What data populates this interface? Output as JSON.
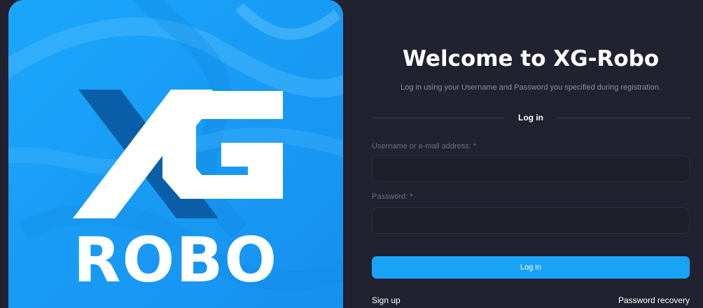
{
  "brand": {
    "logo_letters": "XG",
    "wordmark": "ROBO",
    "background_color": "#1a9df7"
  },
  "login": {
    "title": "Welcome to XG-Robo",
    "subtitle": "Log in using your Username and Password you specified during registration.",
    "section_title": "Log in",
    "username_label": "Username or e-mail address: *",
    "username_value": "",
    "password_label": "Password: *",
    "password_value": "",
    "submit_label": "Log in",
    "signup_link": "Sign up",
    "recovery_link": "Password recovery"
  },
  "colors": {
    "page_background": "#222130",
    "accent": "#19a3f7",
    "input_background": "#1f1e2b",
    "muted_text": "#8e8d9f"
  }
}
